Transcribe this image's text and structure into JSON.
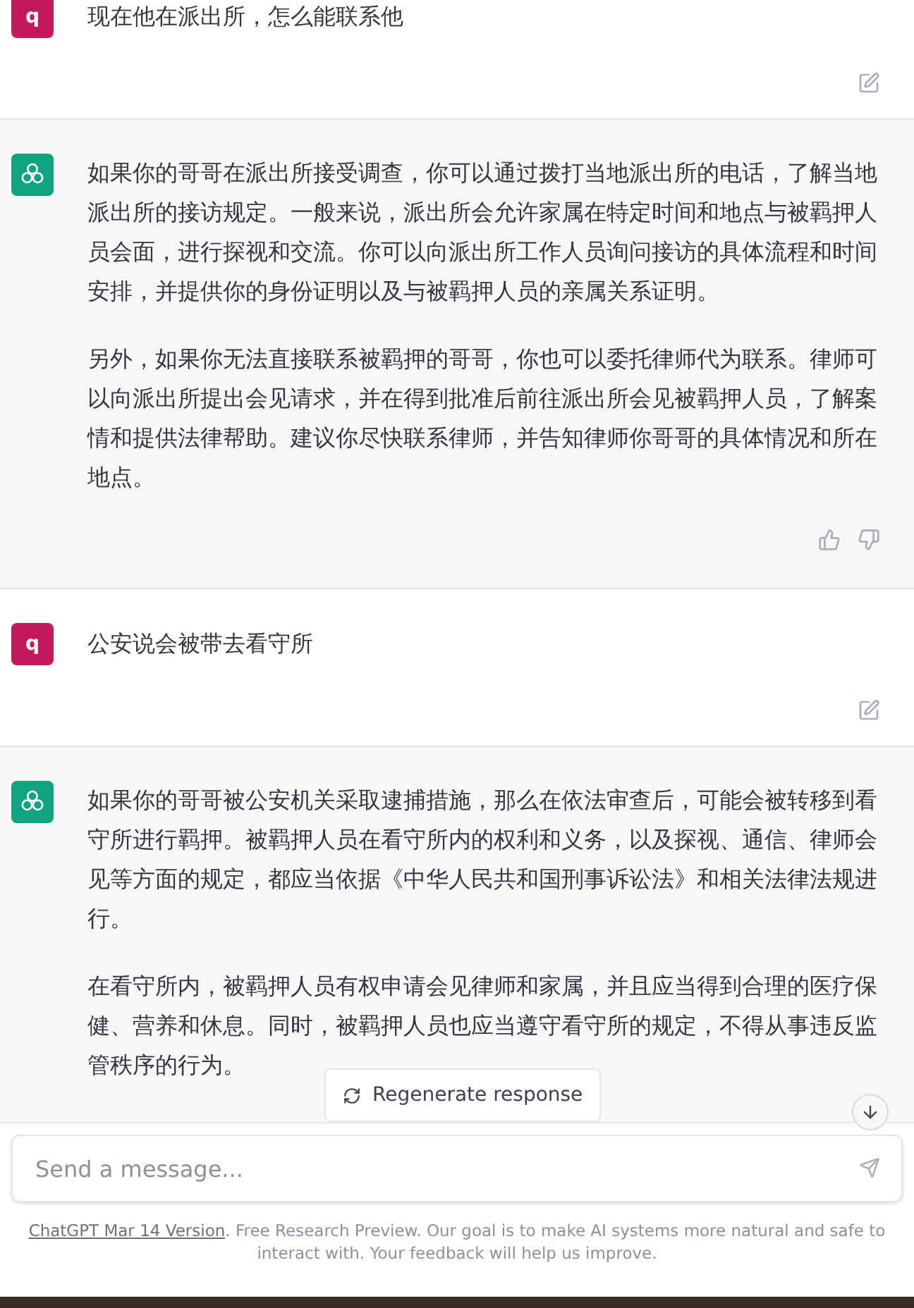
{
  "messages": [
    {
      "kind": "user",
      "avatar": "q",
      "paragraphs": [
        "现在他在派出所，怎么能联系他"
      ]
    },
    {
      "kind": "assistant",
      "feedback_icons": true,
      "paragraphs": [
        "如果你的哥哥在派出所接受调查，你可以通过拨打当地派出所的电话，了解当地派出所的接访规定。一般来说，派出所会允许家属在特定时间和地点与被羁押人员会面，进行探视和交流。你可以向派出所工作人员询问接访的具体流程和时间安排，并提供你的身份证明以及与被羁押人员的亲属关系证明。",
        "另外，如果你无法直接联系被羁押的哥哥，你也可以委托律师代为联系。律师可以向派出所提出会见请求，并在得到批准后前往派出所会见被羁押人员，了解案情和提供法律帮助。建议你尽快联系律师，并告知律师你哥哥的具体情况和所在地点。"
      ]
    },
    {
      "kind": "user",
      "avatar": "q",
      "paragraphs": [
        "公安说会被带去看守所"
      ]
    },
    {
      "kind": "assistant",
      "feedback_icons": false,
      "paragraphs": [
        "如果你的哥哥被公安机关采取逮捕措施，那么在依法审查后，可能会被转移到看守所进行羁押。被羁押人员在看守所内的权利和义务，以及探视、通信、律师会见等方面的规定，都应当依据《中华人民共和国刑事诉讼法》和相关法律法规进行。",
        "在看守所内，被羁押人员有权申请会见律师和家属，并且应当得到合理的医疗保健、营养和休息。同时，被羁押人员也应当遵守看守所的规定，不得从事违反监管秩序的行为。"
      ]
    }
  ],
  "regenerate_button": "Regenerate response",
  "composer": {
    "placeholder": "Send a message..."
  },
  "footer": {
    "link": "ChatGPT Mar 14 Version",
    "text": ". Free Research Preview. Our goal is to make AI systems more natural and safe to interact with. Your feedback will help us improve."
  }
}
